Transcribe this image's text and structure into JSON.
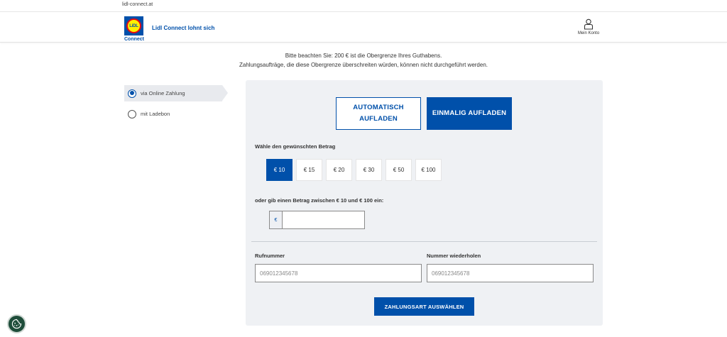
{
  "browser": {
    "url": "lidl-connect.at"
  },
  "header": {
    "logo_text": "LiDL",
    "logo_sub": "Connect",
    "tagline": "Lidl Connect lohnt sich",
    "account_label": "Mein Konto",
    "account_icon": "user-icon"
  },
  "notice": {
    "line1": "Bitte beachten Sie: 200 € ist die Obergrenze Ihres Guthabens.",
    "line2": "Zahlungsaufträge, die diese Obergrenze überschreiten würden, können nicht durchgeführt werden."
  },
  "sidebar": {
    "items": [
      {
        "label": "via Online Zahlung",
        "checked": true
      },
      {
        "label": "mit Ladebon",
        "checked": false
      }
    ]
  },
  "topup": {
    "mode_auto_line1": "AUTOMATISCH",
    "mode_auto_line2": "AUFLADEN",
    "mode_once": "EINMALIG AUFLADEN",
    "choose_label": "Wähle den gewünschten Betrag",
    "amounts": [
      "€ 10",
      "€ 15",
      "€ 20",
      "€ 30",
      "€ 50",
      "€ 100"
    ],
    "selected_amount": "€ 10",
    "custom_label": "oder gib einen Betrag zwischen € 10 und € 100 ein:",
    "currency_symbol": "€",
    "custom_value": ""
  },
  "phone": {
    "number_label": "Rufnummer",
    "number_placeholder": "069012345678",
    "repeat_label": "Nummer wiederholen",
    "repeat_placeholder": "069012345678"
  },
  "submit_label": "ZAHLUNGSART AUSWÄHLEN",
  "cookie_icon": "cookie-icon",
  "colors": {
    "brand_blue": "#0050aa",
    "panel_bg": "#eff1f4",
    "logo_yellow": "#fff000",
    "logo_red": "#e60a14"
  }
}
